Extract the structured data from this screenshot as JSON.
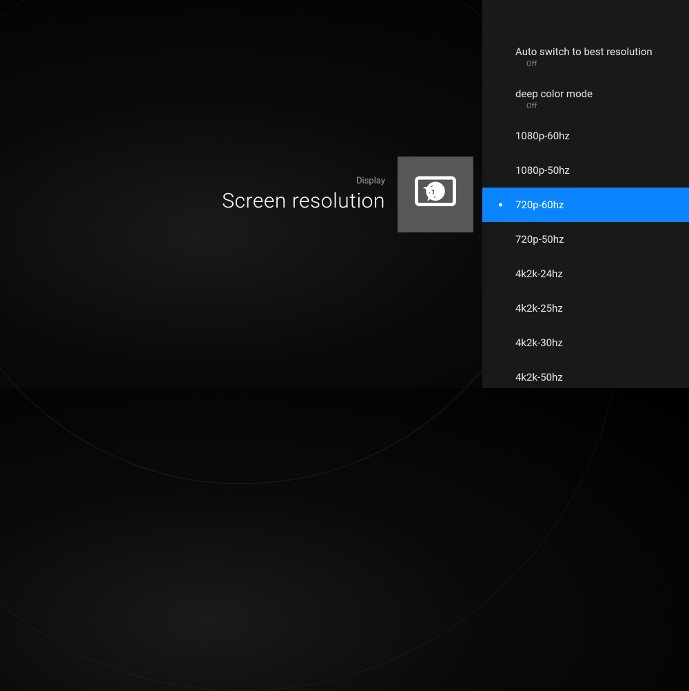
{
  "header": {
    "category": "Display",
    "title": "Screen resolution"
  },
  "menu": {
    "items": [
      {
        "label": "Auto switch to best resolution",
        "value": "Off",
        "selected": false
      },
      {
        "label": "deep color mode",
        "value": "Off",
        "selected": false
      },
      {
        "label": "1080p-60hz",
        "value": null,
        "selected": false
      },
      {
        "label": "1080p-50hz",
        "value": null,
        "selected": false
      },
      {
        "label": "720p-60hz",
        "value": null,
        "selected": true
      },
      {
        "label": "720p-50hz",
        "value": null,
        "selected": false
      },
      {
        "label": "4k2k-24hz",
        "value": null,
        "selected": false
      },
      {
        "label": "4k2k-25hz",
        "value": null,
        "selected": false
      },
      {
        "label": "4k2k-30hz",
        "value": null,
        "selected": false
      },
      {
        "label": "4k2k-50hz",
        "value": null,
        "selected": false
      }
    ]
  },
  "colors": {
    "accent": "#0a84ff",
    "panelBg": "#191919",
    "iconBg": "#575757"
  }
}
